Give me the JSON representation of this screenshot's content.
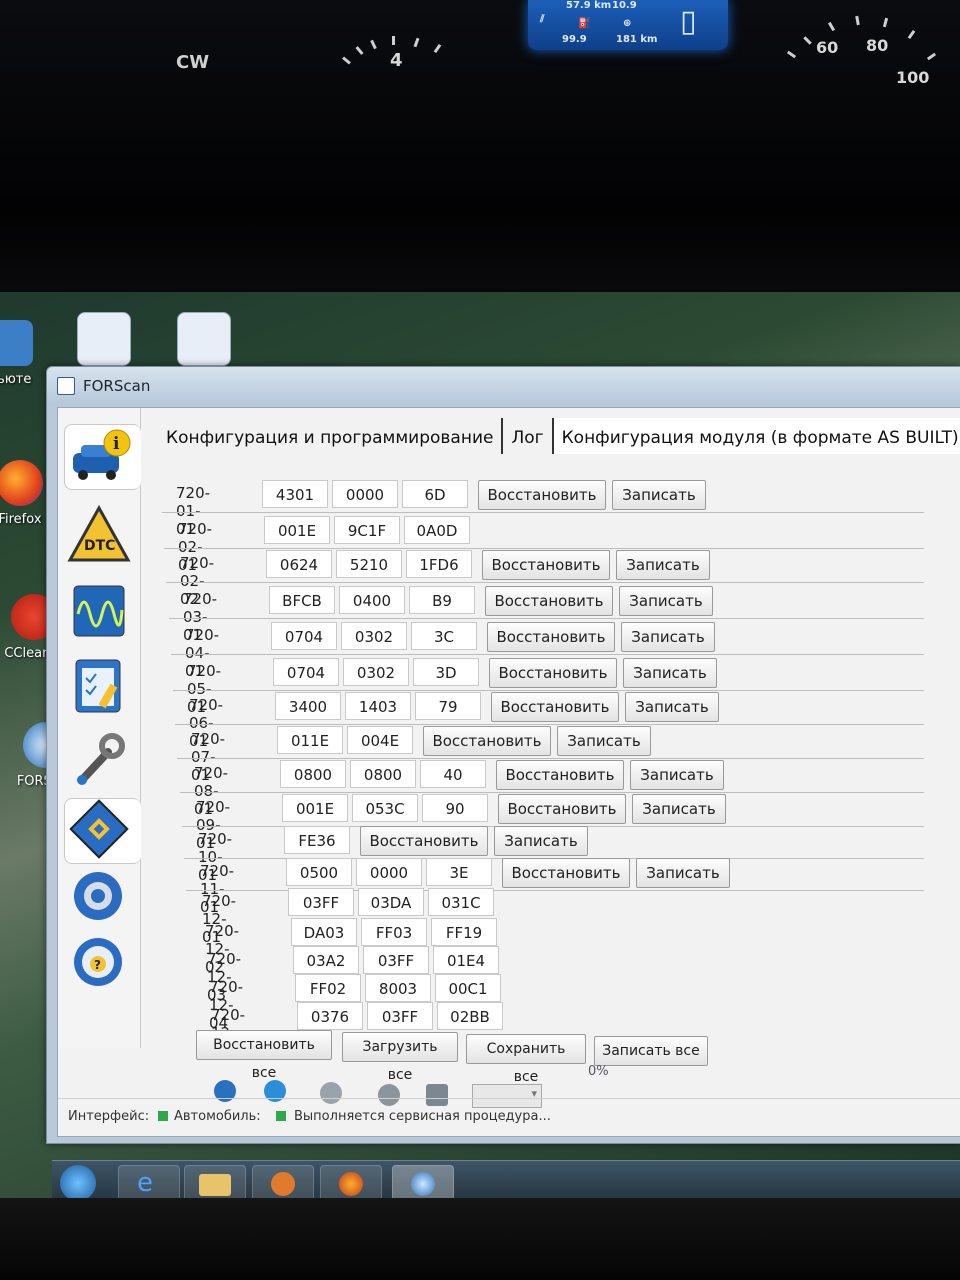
{
  "dashboard": {
    "trip_distance": "57.9 km",
    "trip_value2": "10.9",
    "odometer": "99.9",
    "range": "181 km",
    "tacho_mark": "4",
    "speed_marks": [
      "60",
      "80",
      "100"
    ],
    "cluster_small": "CW"
  },
  "desktop_icons": [
    {
      "name": "computer",
      "label": "ньюте"
    },
    {
      "name": "firefox",
      "label": "Firefox"
    },
    {
      "name": "ccleaner",
      "label": "CCleaner"
    },
    {
      "name": "forscan",
      "label": "FORScan"
    }
  ],
  "window": {
    "title": "FORScan"
  },
  "tabs": [
    {
      "label": "Конфигурация и программирование"
    },
    {
      "label": "Лог"
    },
    {
      "label": "Конфигурация модуля (в формате AS BUILT)"
    }
  ],
  "rows": [
    {
      "id": "720-01-01",
      "cells": [
        "4301",
        "0000",
        "6D"
      ],
      "restore": "Восстановить",
      "write": "Записать"
    },
    {
      "id": "720-02-01",
      "cells": [
        "001E",
        "9C1F",
        "0A0D"
      ]
    },
    {
      "id": "720-02-02",
      "cells": [
        "0624",
        "5210",
        "1FD6"
      ],
      "restore": "Восстановить",
      "write": "Записать"
    },
    {
      "id": "720-03-01",
      "cells": [
        "BFCB",
        "0400",
        "B9"
      ],
      "restore": "Восстановить",
      "write": "Записать"
    },
    {
      "id": "720-04-01",
      "cells": [
        "0704",
        "0302",
        "3C"
      ],
      "restore": "Восстановить",
      "write": "Записать"
    },
    {
      "id": "720-05-01",
      "cells": [
        "0704",
        "0302",
        "3D"
      ],
      "restore": "Восстановить",
      "write": "Записать"
    },
    {
      "id": "720-06-01",
      "cells": [
        "3400",
        "1403",
        "79"
      ],
      "restore": "Восстановить",
      "write": "Записать"
    },
    {
      "id": "720-07-01",
      "cells": [
        "011E",
        "004E"
      ],
      "restore": "Восстановить",
      "write": "Записать"
    },
    {
      "id": "720-08-01",
      "cells": [
        "0800",
        "0800",
        "40"
      ],
      "restore": "Восстановить",
      "write": "Записать"
    },
    {
      "id": "720-09-01",
      "cells": [
        "001E",
        "053C",
        "90"
      ],
      "restore": "Восстановить",
      "write": "Записать"
    },
    {
      "id": "720-10-01",
      "cells": [
        "FE36"
      ],
      "restore": "Восстановить",
      "write": "Записать"
    },
    {
      "id": "720-11-01",
      "cells": [
        "0500",
        "0000",
        "3E"
      ],
      "restore": "Восстановить",
      "write": "Записать"
    },
    {
      "id": "720-12-01",
      "cells": [
        "03FF",
        "03DA",
        "031C"
      ]
    },
    {
      "id": "720-12-02",
      "cells": [
        "DA03",
        "FF03",
        "FF19"
      ]
    },
    {
      "id": "720-12-03",
      "cells": [
        "03A2",
        "03FF",
        "01E4"
      ]
    },
    {
      "id": "720-12-04",
      "cells": [
        "FF02",
        "8003",
        "00C1"
      ]
    },
    {
      "id": "720-12-05",
      "cells": [
        "0376",
        "03FF",
        "02BB"
      ]
    }
  ],
  "bottom_buttons": {
    "restore_all": "Восстановить все",
    "load_all": "Загрузить все",
    "save_all": "Сохранить все",
    "write_all": "Записать все"
  },
  "progress": "0%",
  "status": {
    "interface_label": "Интерфейс:",
    "vehicle_label": "Автомобиль:",
    "message": "Выполняется сервисная процедура..."
  },
  "colors": {
    "led_ok": "#2ea84a",
    "accent": "#1f5fb0"
  }
}
